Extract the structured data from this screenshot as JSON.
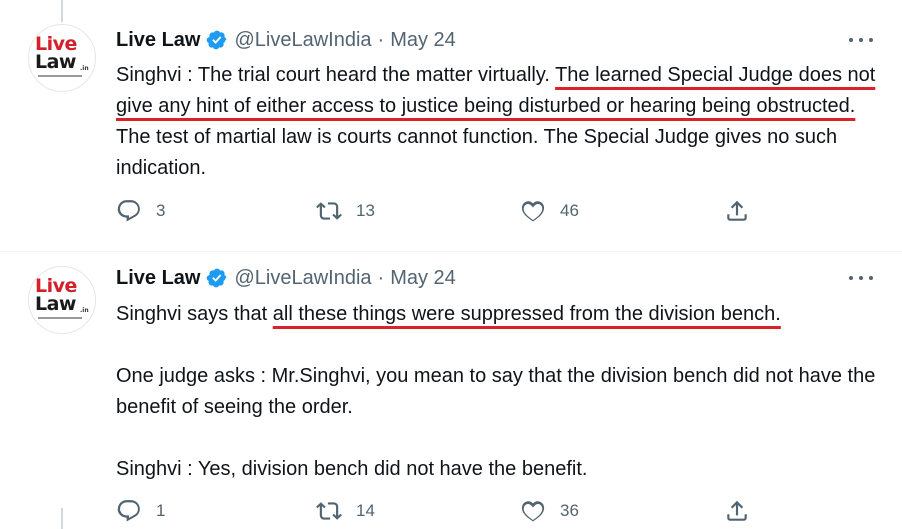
{
  "tweets": [
    {
      "author": "Live Law",
      "handle": "@LiveLawIndia",
      "separator": "·",
      "date": "May 24",
      "avatar": {
        "line1": "Live",
        "line2": "Law",
        "suffix": ".in"
      },
      "text": {
        "p1_plain_start": "Singhvi : The trial court heard the matter virtually. ",
        "p1_underlined": "The learned Special Judge does not give any hint of either access to justice being disturbed or hearing being obstructed.",
        "p1_plain_end": " The test of martial law is courts cannot function. The Special Judge gives no such indication."
      },
      "replies": "3",
      "retweets": "13",
      "likes": "46"
    },
    {
      "author": "Live Law",
      "handle": "@LiveLawIndia",
      "separator": "·",
      "date": "May 24",
      "avatar": {
        "line1": "Live",
        "line2": "Law",
        "suffix": ".in"
      },
      "text": {
        "p1_plain_start": "Singhvi says that ",
        "p1_underlined": "all these things were suppressed from the division bench.",
        "p2": "One judge asks : Mr.Singhvi, you mean to say that the division bench did not have the benefit of seeing the order.",
        "p3": "Singhvi : Yes, division bench did not have the benefit."
      },
      "replies": "1",
      "retweets": "14",
      "likes": "36"
    }
  ],
  "colors": {
    "underline": "#d8232a",
    "verified": "#1d9bf0",
    "muted": "#536471",
    "logo_red": "#d3202a"
  },
  "icons": [
    "verified-badge-icon",
    "more-icon",
    "reply-icon",
    "retweet-icon",
    "like-icon",
    "share-icon"
  ]
}
